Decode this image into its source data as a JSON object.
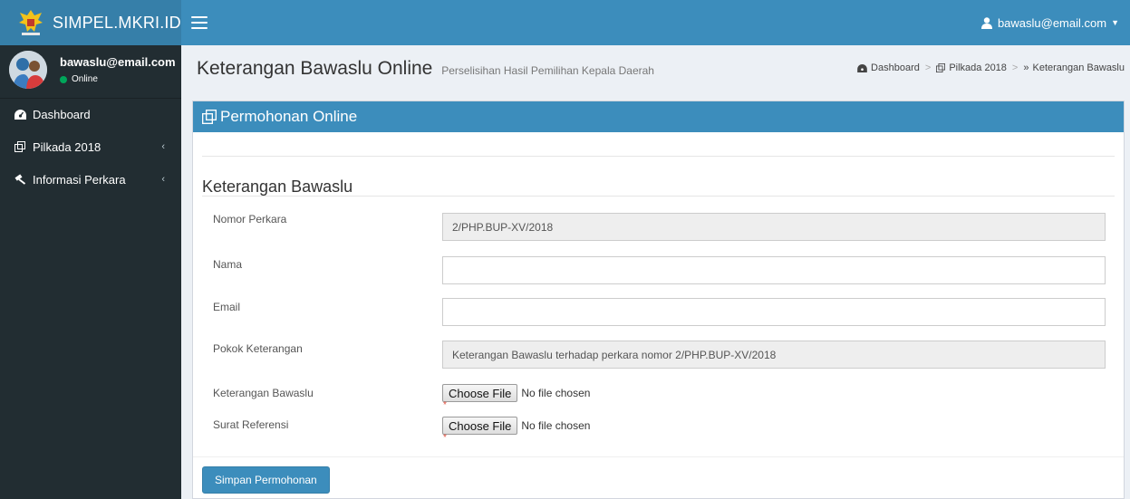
{
  "brand": {
    "title": "SIMPEL.MKRI.ID"
  },
  "navbar": {
    "user_email": "bawaslu@email.com"
  },
  "sidebar": {
    "user": {
      "name": "bawaslu@email.com",
      "status": "Online",
      "status_color": "#00a65a"
    },
    "items": [
      {
        "label": "Dashboard",
        "icon": "dashboard-icon"
      },
      {
        "label": "Pilkada 2018",
        "icon": "copy-icon"
      },
      {
        "label": "Informasi Perkara",
        "icon": "gavel-icon"
      }
    ]
  },
  "header": {
    "title": "Keterangan Bawaslu Online",
    "subtitle": "Perselisihan Hasil Pemilihan Kepala Daerah",
    "breadcrumb": [
      "Dashboard",
      "Pilkada 2018",
      "Keterangan Bawaslu"
    ]
  },
  "box": {
    "title": "Permohonan Online",
    "section_title": "Keterangan Bawaslu",
    "fields": {
      "nomor_perkara": {
        "label": "Nomor Perkara",
        "value": "2/PHP.BUP-XV/2018"
      },
      "nama": {
        "label": "Nama",
        "value": ""
      },
      "email": {
        "label": "Email",
        "value": ""
      },
      "pokok_keterangan": {
        "label": "Pokok Keterangan",
        "value": "Keterangan Bawaslu terhadap perkara nomor 2/PHP.BUP-XV/2018"
      },
      "keterangan_bawaslu": {
        "label": "Keterangan Bawaslu",
        "button": "Choose File",
        "status": "No file chosen"
      },
      "surat_referensi": {
        "label": "Surat Referensi",
        "button": "Choose File",
        "status": "No file chosen"
      }
    },
    "required_mark": "*",
    "submit_label": "Simpan Permohonan"
  },
  "colors": {
    "primary": "#3c8dbc",
    "primary_dark": "#367fa9",
    "sidebar": "#222d32",
    "required": "#dd4b39"
  }
}
